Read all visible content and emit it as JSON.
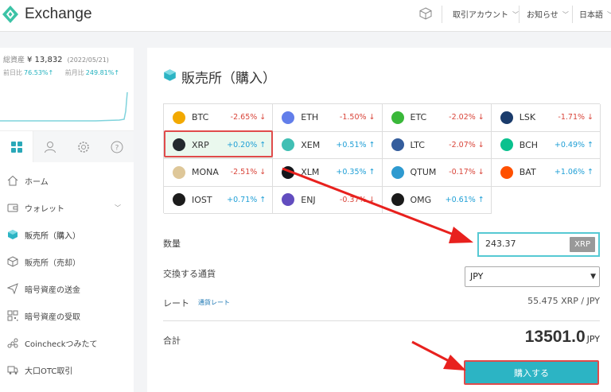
{
  "app": {
    "title": "Exchange"
  },
  "header": {
    "menus": [
      {
        "label": "取引アカウント"
      },
      {
        "label": "お知らせ"
      },
      {
        "label": "日本語"
      }
    ]
  },
  "account": {
    "total_label": "総資産",
    "total_value": "¥ 13,832",
    "date": "(2022/05/21)",
    "day_label": "前日比",
    "day_change": "76.53%↑",
    "month_label": "前月比",
    "month_change": "249.81%↑"
  },
  "sidebar": {
    "tabs": [
      {
        "icon": "grid-icon"
      },
      {
        "icon": "user-icon"
      },
      {
        "icon": "gear-icon"
      },
      {
        "icon": "help-icon"
      }
    ],
    "items": [
      {
        "label": "ホーム",
        "icon": "home-icon"
      },
      {
        "label": "ウォレット",
        "icon": "wallet-icon"
      },
      {
        "label": "販売所（購入）",
        "icon": "cube-filled-icon"
      },
      {
        "label": "販売所（売却）",
        "icon": "cube-outline-icon"
      },
      {
        "label": "暗号資産の送金",
        "icon": "send-icon"
      },
      {
        "label": "暗号資産の受取",
        "icon": "qr-icon"
      },
      {
        "label": "Coincheckつみたて",
        "icon": "coins-icon"
      },
      {
        "label": "大口OTC取引",
        "icon": "truck-icon"
      }
    ]
  },
  "page": {
    "title": "販売所（購入）"
  },
  "coins": [
    {
      "name": "BTC",
      "change": "-2.65%",
      "dir": "down",
      "color": "#f2a900"
    },
    {
      "name": "ETH",
      "change": "-1.50%",
      "dir": "down",
      "color": "#627eea"
    },
    {
      "name": "ETC",
      "change": "-2.02%",
      "dir": "down",
      "color": "#3ab83a"
    },
    {
      "name": "LSK",
      "change": "-1.71%",
      "dir": "down",
      "color": "#1a3b6b"
    },
    {
      "name": "XRP",
      "change": "+0.20%",
      "dir": "up",
      "color": "#23292f",
      "selected": true
    },
    {
      "name": "XEM",
      "change": "+0.51%",
      "dir": "up",
      "color": "#41bfb4"
    },
    {
      "name": "LTC",
      "change": "-2.07%",
      "dir": "down",
      "color": "#345d9d"
    },
    {
      "name": "BCH",
      "change": "+0.49%",
      "dir": "up",
      "color": "#0ac18e"
    },
    {
      "name": "MONA",
      "change": "-2.51%",
      "dir": "down",
      "color": "#dec799"
    },
    {
      "name": "XLM",
      "change": "+0.35%",
      "dir": "up",
      "color": "#14161b"
    },
    {
      "name": "QTUM",
      "change": "-0.17%",
      "dir": "down",
      "color": "#2e9ad0"
    },
    {
      "name": "BAT",
      "change": "+1.06%",
      "dir": "up",
      "color": "#ff5000"
    },
    {
      "name": "IOST",
      "change": "+0.71%",
      "dir": "up",
      "color": "#1c1c1c"
    },
    {
      "name": "ENJ",
      "change": "-0.37%",
      "dir": "down",
      "color": "#624dbf"
    },
    {
      "name": "OMG",
      "change": "+0.61%",
      "dir": "up",
      "color": "#1a1a1a"
    }
  ],
  "form": {
    "quantity_label": "数量",
    "quantity_value": "243.37",
    "quantity_unit": "XRP",
    "currency_label": "交換する通貨",
    "currency_value": "JPY",
    "rate_label": "レート",
    "rate_link": "通貨レート",
    "rate_value": "55.475  XRP / JPY",
    "total_label": "合計",
    "total_value": "13501.0",
    "total_unit": "JPY",
    "buy_label": "購入する"
  },
  "colors": {
    "accent": "#2cb4c4",
    "down": "#d9453a",
    "up": "#1f9fd6",
    "highlight": "#e04b4b"
  }
}
